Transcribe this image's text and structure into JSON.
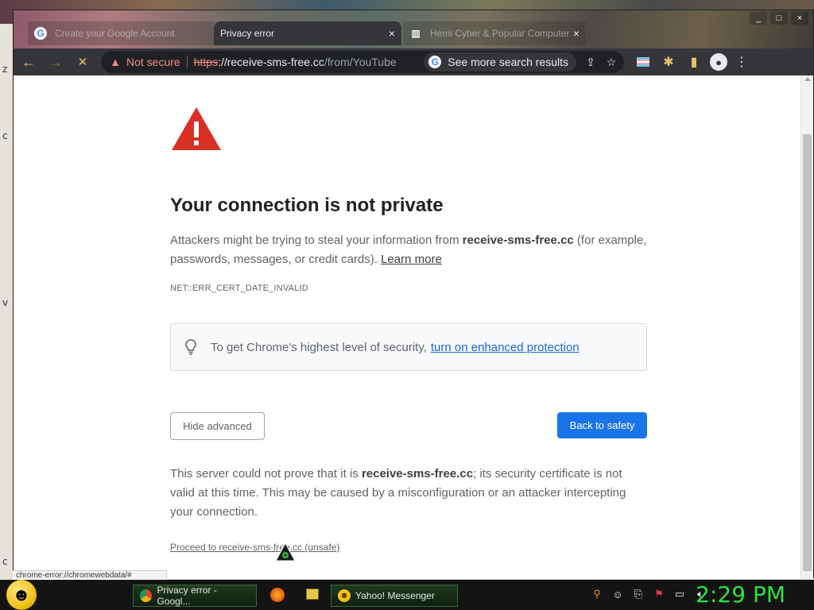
{
  "window_controls": {
    "minimize": "_",
    "maximize": "□",
    "close": "×"
  },
  "tabs": [
    {
      "title": "Create your Google Account",
      "favicon": "G",
      "active": false
    },
    {
      "title": "Privacy error",
      "favicon": "",
      "active": true,
      "close": "×"
    },
    {
      "title": "Hemi Cyber & Popular Computer",
      "favicon": "▥",
      "active": false,
      "close": "×"
    }
  ],
  "toolbar": {
    "back_icon": "←",
    "forward_icon": "→",
    "stop_icon": "✕",
    "security_label": "Not secure",
    "url_scheme": "https",
    "url_host": "://receive-sms-free.cc",
    "url_path": "/from/YouTube",
    "search_pill": "See more search results",
    "share_icon": "⇪",
    "bookmark_icon": "☆",
    "extensions_icon": "✱",
    "sidepanel_icon": "▮",
    "menu_icon": "⋮"
  },
  "page": {
    "title": "Your connection is not private",
    "explanation_before": "Attackers might be trying to steal your information from ",
    "domain": "receive-sms-free.cc",
    "explanation_after": " (for example, passwords, messages, or credit cards). ",
    "learn_more": "Learn more",
    "error_code": "NET::ERR_CERT_DATE_INVALID",
    "enhanced_text": "To get Chrome's highest level of security,",
    "enhanced_link": "turn on enhanced protection",
    "hide_advanced": "Hide advanced",
    "back_to_safety": "Back to safety",
    "details_before": "This server could not prove that it is ",
    "details_after": "; its security certificate is not valid at this time. This may be caused by a misconfiguration or an attacker intercepting your connection.",
    "proceed_link": "Proceed to receive-sms-free.cc (unsafe)"
  },
  "status_url": "chrome-error://chromewebdata/#",
  "taskbar": {
    "tasks": [
      {
        "label": "Privacy error - Googl..."
      },
      {
        "label": "Yahoo! Messenger"
      }
    ],
    "clock": "2:29 PM"
  },
  "colors": {
    "accent_blue": "#1a73e8",
    "error_red": "#d93025",
    "clock_green": "#2fe040"
  }
}
